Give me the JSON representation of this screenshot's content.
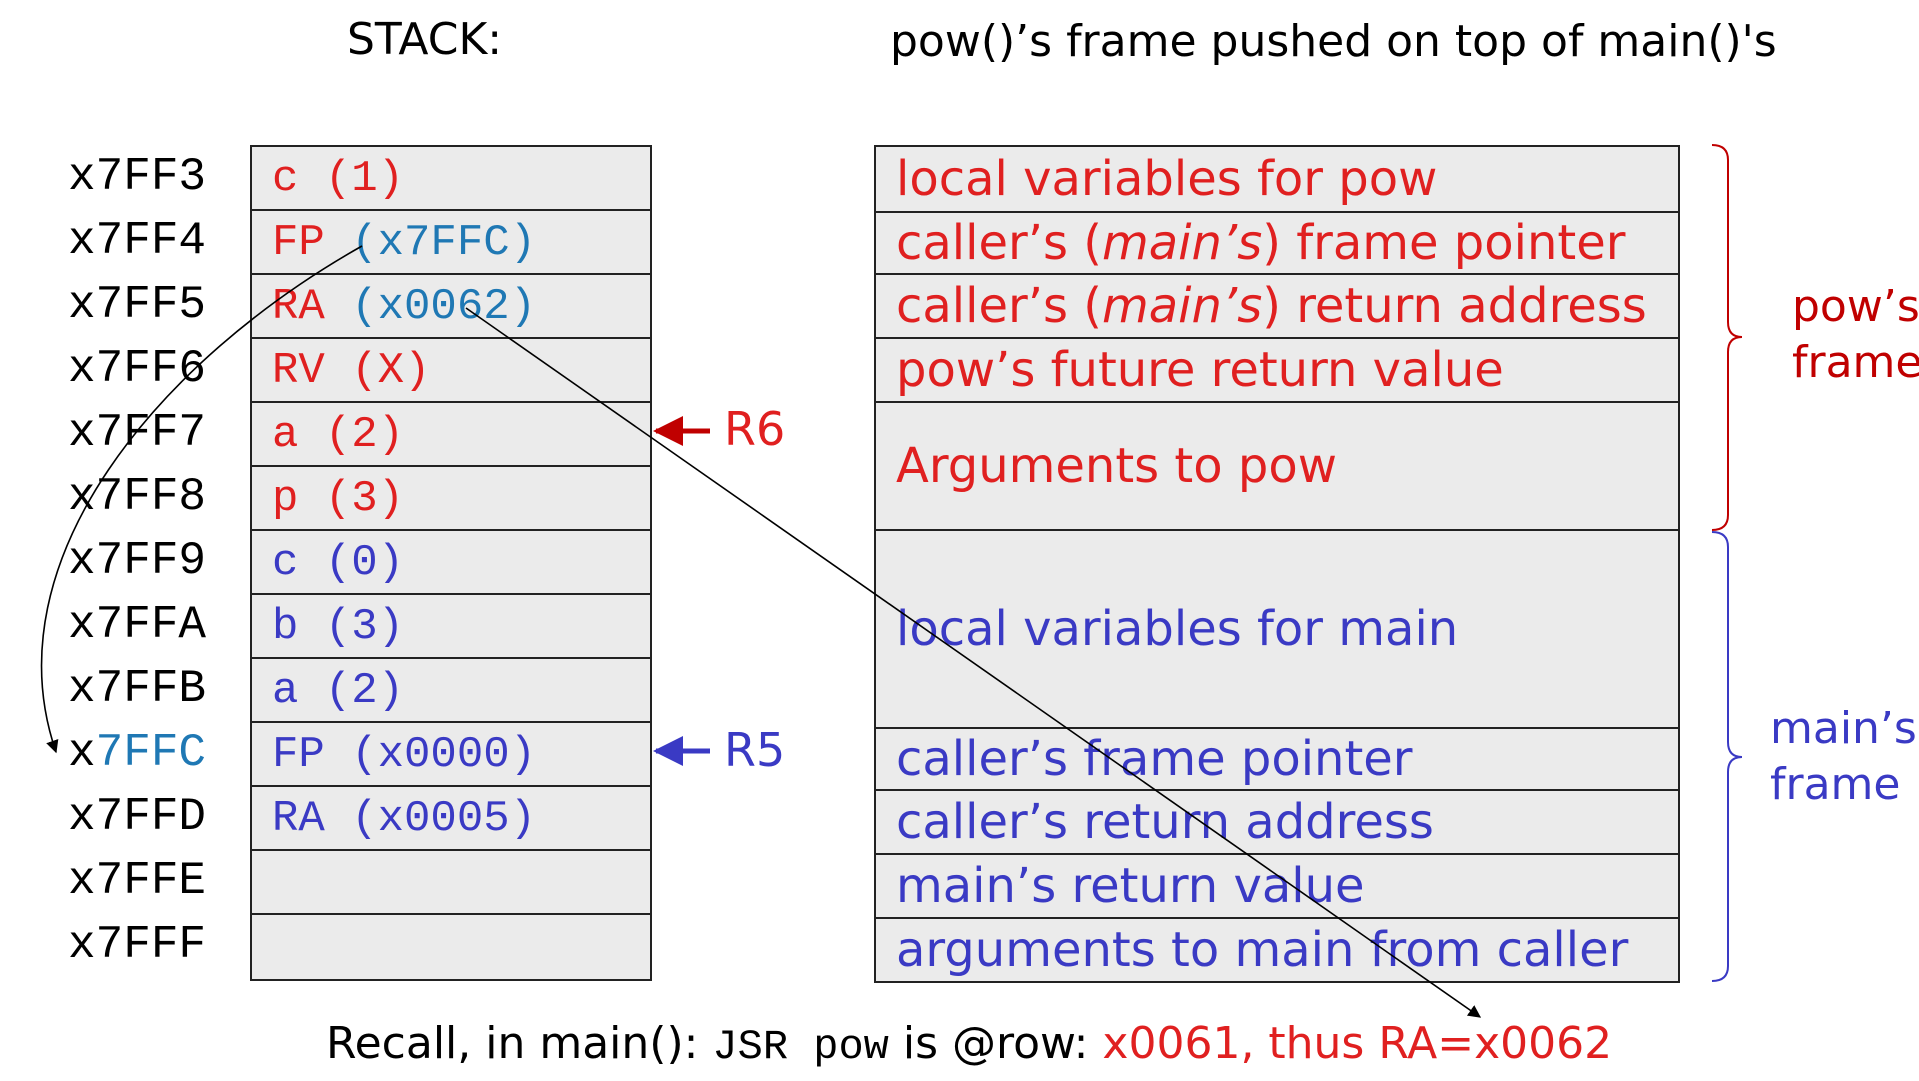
{
  "stack_title": "STACK:",
  "frame_title": "pow()’s frame pushed on top of main()'s",
  "addresses": [
    "x7FF3",
    "x7FF4",
    "x7FF5",
    "x7FF6",
    "x7FF7",
    "x7FF8",
    "x7FF9",
    "x7FFA",
    "x7FFB",
    "x7FFC",
    "x7FFD",
    "x7FFE",
    "x7FFF"
  ],
  "addr_fc_prefix": "x",
  "addr_fc_rest": "7FFC",
  "stack_cells": [
    {
      "a": "c",
      "b": "(1)"
    },
    {
      "a": "FP",
      "b": "(x7FFC)"
    },
    {
      "a": "RA",
      "b": "(x0062)"
    },
    {
      "a": "RV",
      "b": "(X)"
    },
    {
      "a": "a",
      "b": "(2)"
    },
    {
      "a": "p",
      "b": "(3)"
    },
    {
      "a": "c",
      "b": "(0)"
    },
    {
      "a": "b",
      "b": "(3)"
    },
    {
      "a": "a",
      "b": "(2)"
    },
    {
      "a": "FP",
      "b": "(x0000)"
    },
    {
      "a": "RA",
      "b": "(x0005)"
    },
    {
      "a": "",
      "b": ""
    },
    {
      "a": "",
      "b": ""
    }
  ],
  "registers": {
    "r6": "R6",
    "r5": "R5"
  },
  "frame_rows": {
    "pow_locals": "local variables for pow",
    "pow_fp_pre": "caller’s (",
    "pow_fp_it": "main’s",
    "pow_fp_post": ") frame pointer",
    "pow_ra_pre": "caller’s (",
    "pow_ra_it": "main’s",
    "pow_ra_post": ") return address",
    "pow_rv": "pow’s future return value",
    "pow_args": "Arguments to pow",
    "main_locals": "local variables for main",
    "main_fp": "caller’s frame pointer",
    "main_ra": "caller’s return address",
    "main_rv": "main’s return value",
    "main_args": "arguments to main from caller"
  },
  "side_labels": {
    "pow_line1": "pow’s",
    "pow_line2": "frame",
    "main_line1": "main’s",
    "main_line2": "frame"
  },
  "recall": {
    "prefix": "Recall, in main(): ",
    "code": "JSR pow",
    "mid": " is @row: ",
    "row_val": "x0061, thus RA=",
    "ra_val": "x0062"
  },
  "colors": {
    "pow_frame": "#e02020",
    "main_frame": "#3a3ac4",
    "highlight": "#1f78b4",
    "brace_red": "#c00000"
  }
}
